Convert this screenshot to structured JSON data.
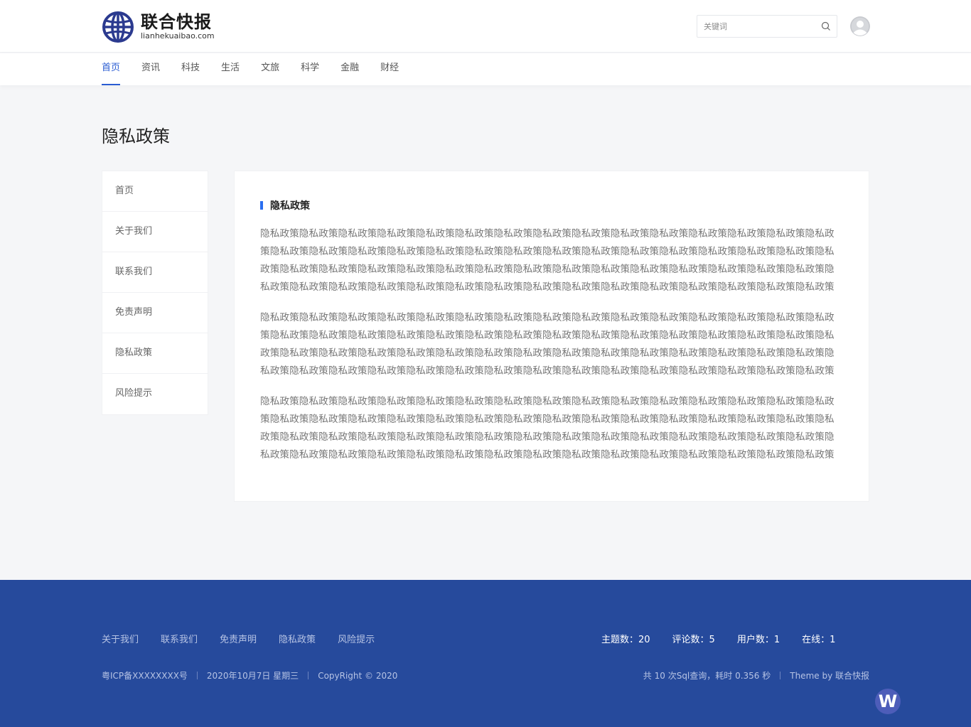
{
  "header": {
    "logo_cn": "联合快报",
    "logo_en": "lianhekuaibao.com",
    "search_placeholder": "关键词"
  },
  "nav": [
    {
      "label": "首页",
      "active": true
    },
    {
      "label": "资讯"
    },
    {
      "label": "科技"
    },
    {
      "label": "生活"
    },
    {
      "label": "文旅"
    },
    {
      "label": "科学"
    },
    {
      "label": "金融"
    },
    {
      "label": "财经"
    }
  ],
  "page_title": "隐私政策",
  "sidebar": [
    {
      "label": "首页"
    },
    {
      "label": "关于我们"
    },
    {
      "label": "联系我们"
    },
    {
      "label": "免责声明"
    },
    {
      "label": "隐私政策"
    },
    {
      "label": "风险提示"
    }
  ],
  "content": {
    "heading": "隐私政策",
    "paragraphs": [
      "隐私政策隐私政策隐私政策隐私政策隐私政策隐私政策隐私政策隐私政策隐私政策隐私政策隐私政策隐私政策隐私政策隐私政策隐私政策隐私政策隐私政策隐私政策隐私政策隐私政策隐私政策隐私政策隐私政策隐私政策隐私政策隐私政策隐私政策隐私政策隐私政策隐私政策隐私政策隐私政策隐私政策隐私政策隐私政策隐私政策隐私政策隐私政策隐私政策隐私政策隐私政策隐私政策隐私政策隐私政策隐私政策隐私政策隐私政策隐私政策隐私政策隐私政策隐私政策隐私政策隐私政策隐私政策隐私政策隐私政策隐私政策隐私政策隐私政策",
      "隐私政策隐私政策隐私政策隐私政策隐私政策隐私政策隐私政策隐私政策隐私政策隐私政策隐私政策隐私政策隐私政策隐私政策隐私政策隐私政策隐私政策隐私政策隐私政策隐私政策隐私政策隐私政策隐私政策隐私政策隐私政策隐私政策隐私政策隐私政策隐私政策隐私政策隐私政策隐私政策隐私政策隐私政策隐私政策隐私政策隐私政策隐私政策隐私政策隐私政策隐私政策隐私政策隐私政策隐私政策隐私政策隐私政策隐私政策隐私政策隐私政策隐私政策隐私政策隐私政策隐私政策隐私政策隐私政策隐私政策隐私政策隐私政策隐私政策",
      "隐私政策隐私政策隐私政策隐私政策隐私政策隐私政策隐私政策隐私政策隐私政策隐私政策隐私政策隐私政策隐私政策隐私政策隐私政策隐私政策隐私政策隐私政策隐私政策隐私政策隐私政策隐私政策隐私政策隐私政策隐私政策隐私政策隐私政策隐私政策隐私政策隐私政策隐私政策隐私政策隐私政策隐私政策隐私政策隐私政策隐私政策隐私政策隐私政策隐私政策隐私政策隐私政策隐私政策隐私政策隐私政策隐私政策隐私政策隐私政策隐私政策隐私政策隐私政策隐私政策隐私政策隐私政策隐私政策隐私政策隐私政策隐私政策隐私政策"
    ]
  },
  "footer": {
    "links": [
      {
        "label": "关于我们"
      },
      {
        "label": "联系我们"
      },
      {
        "label": "免责声明"
      },
      {
        "label": "隐私政策"
      },
      {
        "label": "风险提示"
      }
    ],
    "stats": [
      {
        "label": "主题数：20"
      },
      {
        "label": "评论数：5"
      },
      {
        "label": "用户数：1"
      },
      {
        "label": "在线：1"
      }
    ],
    "icp": "粤ICP备XXXXXXXX号",
    "date": "2020年10月7日 星期三",
    "copyright": "CopyRight © 2020",
    "query_info": "共 10 次Sql查询，耗时 0.356 秒",
    "theme": "Theme by 联合快报"
  },
  "colors": {
    "accent": "#2a5cd2",
    "footer_bg": "#264a9c"
  }
}
